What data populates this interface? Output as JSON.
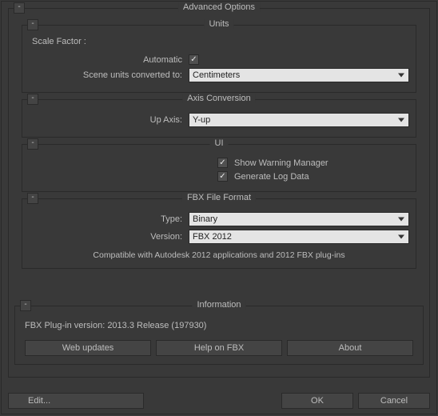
{
  "outer_title": "Advanced Options",
  "units": {
    "title": "Units",
    "collapse": "-",
    "scale_label": "Scale Factor :",
    "automatic_label": "Automatic",
    "automatic_checked": true,
    "converted_label": "Scene units converted to:",
    "converted_value": "Centimeters"
  },
  "axis": {
    "title": "Axis Conversion",
    "collapse": "-",
    "upaxis_label": "Up Axis:",
    "upaxis_value": "Y-up"
  },
  "ui": {
    "title": "UI",
    "collapse": "-",
    "warning_label": "Show Warning Manager",
    "warning_checked": true,
    "log_label": "Generate Log Data",
    "log_checked": true
  },
  "fbx": {
    "title": "FBX File Format",
    "collapse": "-",
    "type_label": "Type:",
    "type_value": "Binary",
    "version_label": "Version:",
    "version_value": "FBX 2012",
    "compat": "Compatible with Autodesk 2012 applications and 2012 FBX plug-ins"
  },
  "info": {
    "title": "Information",
    "collapse": "-",
    "plugin_text": "FBX Plug-in version: 2013.3 Release (197930)",
    "web_btn": "Web updates",
    "help_btn": "Help on FBX",
    "about_btn": "About"
  },
  "bottom": {
    "edit": "Edit...",
    "ok": "OK",
    "cancel": "Cancel"
  }
}
